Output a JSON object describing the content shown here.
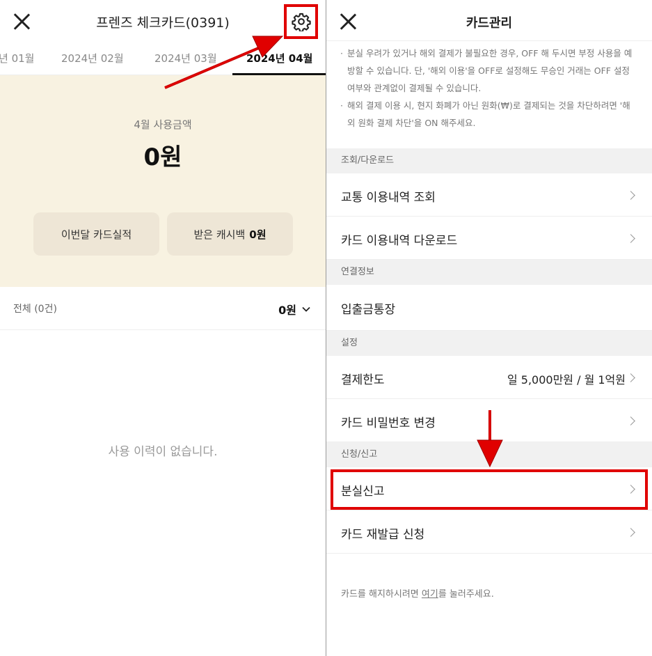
{
  "left": {
    "title": "프렌즈 체크카드(0391)",
    "months": [
      "년 01월",
      "2024년 02월",
      "2024년 03월",
      "2024년 04월"
    ],
    "summary": {
      "label": "4월 사용금액",
      "amount": "0원",
      "btn_performance": "이번달 카드실적",
      "btn_cashback_label": "받은 캐시백",
      "btn_cashback_value": "0원"
    },
    "filter": {
      "label": "전체 (0건)",
      "total": "0원"
    },
    "empty_text": "사용 이력이 없습니다."
  },
  "right": {
    "title": "카드관리",
    "notice": [
      "분실 우려가 있거나 해외 결제가 불필요한 경우, OFF 해 두시면 부정 사용을 예방할 수 있습니다. 단, '해외 이용'을 OFF로 설정해도 무승인 거래는 OFF 설정 여부와 관계없이 결제될 수 있습니다.",
      "해외 결제 이용 시, 현지 화폐가 아닌 원화(₩)로 결제되는 것을 차단하려면 '해외 원화 결제 차단'을 ON 해주세요."
    ],
    "sections": {
      "inquiry": "조회/다운로드",
      "linked": "연결정보",
      "settings": "설정",
      "request": "신청/신고"
    },
    "rows": {
      "transit": "교통 이용내역 조회",
      "download": "카드 이용내역 다운로드",
      "account": "입출금통장",
      "limit": "결제한도",
      "limit_value": "일 5,000만원 / 월 1억원",
      "pin": "카드 비밀번호 변경",
      "lost": "분실신고",
      "reissue": "카드 재발급 신청"
    },
    "footer": {
      "prefix": "카드를 해지하시려면 ",
      "link": "여기",
      "suffix": "를 눌러주세요."
    }
  },
  "colors": {
    "annotation_red": "#e00000",
    "summary_bg": "#f8f2e1",
    "section_bg": "#f1f1f1"
  }
}
